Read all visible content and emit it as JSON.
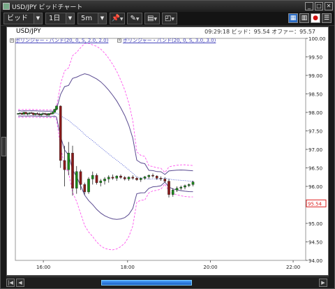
{
  "window": {
    "title": "USD/JPY ビッドチャート",
    "buttons": {
      "minimize": "_",
      "maximize": "□",
      "close": "✕"
    }
  },
  "toolbar": {
    "price_type": "ビッド",
    "period": "1日",
    "interval": "5m",
    "dropdown_arrow": "▼",
    "tools": [
      {
        "name": "pin-tool",
        "glyph": "📌"
      },
      {
        "name": "draw-tool",
        "glyph": "✎"
      },
      {
        "name": "print-tool",
        "glyph": "▤"
      },
      {
        "name": "chart-tool",
        "glyph": "◰"
      }
    ],
    "right_icons": [
      {
        "name": "layout-icon",
        "glyph": "▦",
        "color": "#2b6cc4"
      },
      {
        "name": "grid-icon",
        "glyph": "▥",
        "color": "#3a3a3a"
      },
      {
        "name": "alert-icon",
        "glyph": "●",
        "color": "#d01010"
      },
      {
        "name": "settings-icon",
        "glyph": "☰",
        "color": "#3a3a3a"
      }
    ]
  },
  "header": {
    "symbol": "USD/JPY",
    "time": "09:29:18",
    "bid_label": "ビッド：",
    "bid_value": "95.54",
    "offer_label": "オファー：",
    "offer_value": "95.57"
  },
  "legend": [
    {
      "label": "ボリンジャー・バンド(20, 0, S, 2.0, 2.0)",
      "color": "#4444bb"
    },
    {
      "label": "ボリンジャー・バンド(20, 0, S, 3.0, 3.0)",
      "color": "#4444bb"
    }
  ],
  "chart_data": {
    "type": "candlestick",
    "ylim": [
      94.0,
      100.0
    ],
    "y_ticks": [
      "100.00",
      "99.50",
      "99.00",
      "98.50",
      "98.00",
      "97.50",
      "97.00",
      "96.50",
      "96.00",
      "95.50",
      "95.00",
      "94.50",
      "94.00"
    ],
    "x_ticks": [
      {
        "label": "16:00",
        "pos": 0.0965
      },
      {
        "label": "18:00",
        "pos": 0.3864
      },
      {
        "label": "20:00",
        "pos": 0.6718
      },
      {
        "label": "22:00",
        "pos": 0.9569
      }
    ],
    "last_price": "95.54",
    "colors": {
      "up": "#1a8a1a",
      "down": "#8b1a1a",
      "band2": "#5a4a90",
      "band3": "#ff55ee",
      "ma": "#3344cc"
    },
    "candles": [
      [
        97.96,
        97.98,
        97.94,
        97.97
      ],
      [
        97.97,
        98.0,
        97.95,
        97.98
      ],
      [
        97.98,
        97.99,
        97.93,
        97.95
      ],
      [
        97.95,
        98.02,
        97.94,
        98.0
      ],
      [
        98.0,
        98.02,
        97.95,
        97.96
      ],
      [
        97.96,
        97.99,
        97.92,
        97.97
      ],
      [
        97.97,
        98.0,
        97.94,
        97.99
      ],
      [
        97.99,
        98.01,
        97.96,
        97.98
      ],
      [
        97.98,
        98.0,
        97.92,
        97.94
      ],
      [
        97.94,
        97.98,
        97.92,
        97.97
      ],
      [
        97.97,
        98.0,
        97.94,
        97.95
      ],
      [
        97.95,
        97.99,
        97.91,
        97.93
      ],
      [
        97.93,
        97.97,
        97.89,
        97.96
      ],
      [
        97.96,
        98.0,
        97.93,
        97.97
      ],
      [
        97.97,
        97.99,
        97.93,
        97.95
      ],
      [
        97.95,
        97.98,
        97.9,
        97.93
      ],
      [
        97.93,
        97.98,
        97.9,
        97.97
      ],
      [
        97.97,
        98.0,
        97.94,
        97.96
      ],
      [
        97.96,
        98.02,
        97.95,
        98.0
      ],
      [
        98.0,
        98.1,
        97.99,
        98.08
      ],
      [
        98.08,
        98.2,
        98.05,
        98.17
      ],
      [
        98.17,
        98.19,
        96.5,
        96.7
      ],
      [
        96.7,
        97.1,
        96.0,
        96.45
      ],
      [
        96.45,
        97.2,
        96.3,
        96.9
      ],
      [
        96.9,
        97.1,
        95.75,
        95.95
      ],
      [
        95.95,
        96.55,
        95.8,
        96.4
      ],
      [
        96.4,
        96.45,
        95.9,
        96.05
      ],
      [
        96.05,
        96.1,
        95.78,
        95.85
      ],
      [
        95.85,
        96.25,
        95.8,
        96.2
      ],
      [
        96.2,
        96.4,
        96.05,
        96.3
      ],
      [
        96.3,
        96.35,
        96.05,
        96.1
      ],
      [
        96.1,
        96.2,
        96.0,
        96.15
      ],
      [
        96.15,
        96.25,
        96.05,
        96.2
      ],
      [
        96.2,
        96.3,
        96.1,
        96.25
      ],
      [
        96.25,
        96.32,
        96.18,
        96.22
      ],
      [
        96.22,
        96.3,
        96.15,
        96.28
      ],
      [
        96.28,
        96.32,
        96.2,
        96.24
      ],
      [
        96.24,
        96.28,
        96.16,
        96.2
      ],
      [
        96.2,
        96.27,
        96.15,
        96.25
      ],
      [
        96.25,
        96.3,
        96.18,
        96.22
      ],
      [
        96.22,
        96.26,
        96.15,
        96.18
      ],
      [
        96.18,
        96.24,
        96.12,
        96.22
      ],
      [
        96.22,
        96.28,
        96.18,
        96.26
      ],
      [
        96.26,
        96.32,
        96.2,
        96.3
      ],
      [
        96.3,
        96.35,
        96.24,
        96.28
      ],
      [
        96.28,
        96.3,
        96.18,
        96.22
      ],
      [
        96.22,
        96.27,
        96.15,
        96.2
      ],
      [
        96.2,
        96.25,
        96.1,
        96.14
      ],
      [
        96.14,
        96.2,
        95.7,
        95.78
      ],
      [
        95.78,
        95.95,
        95.72,
        95.9
      ],
      [
        95.9,
        96.0,
        95.85,
        95.95
      ],
      [
        95.95,
        96.02,
        95.9,
        95.98
      ],
      [
        95.98,
        96.05,
        95.92,
        96.02
      ],
      [
        96.02,
        96.08,
        95.98,
        96.05
      ],
      [
        96.05,
        96.15,
        96.0,
        96.12
      ]
    ]
  },
  "scrollbar": {
    "left": "◀",
    "right": "▶",
    "first": "|◀"
  }
}
